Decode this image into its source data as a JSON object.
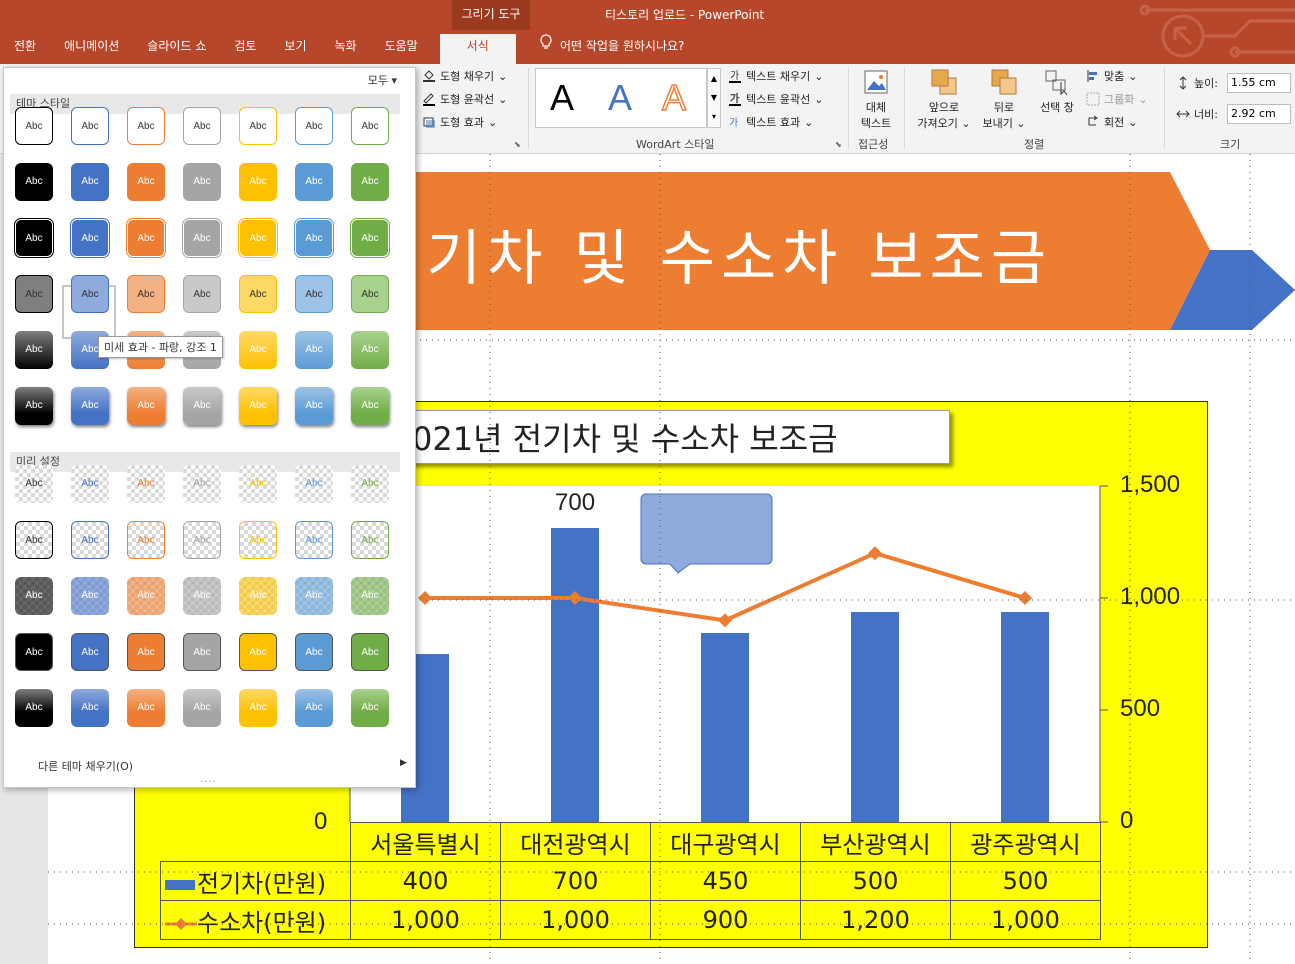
{
  "window": {
    "context_group": "그리기 도구",
    "doc_title": "티스토리 업로드  -  PowerPoint"
  },
  "tabs": [
    "전환",
    "애니메이션",
    "슬라이드 쇼",
    "검토",
    "보기",
    "녹화",
    "도움말",
    "서식"
  ],
  "active_tab": "서식",
  "tell_me": "어떤 작업을 원하시나요?",
  "ribbon": {
    "shape_fill": "도형 채우기",
    "shape_outline": "도형 윤곽선",
    "shape_effects": "도형 효과",
    "wordart_sample": "A",
    "text_fill": "텍스트 채우기",
    "text_outline": "텍스트 윤곽선",
    "text_effects": "텍스트 효과",
    "wordart_group": "WordArt 스타일",
    "alt_text_line1": "대체",
    "alt_text_line2": "텍스트",
    "accessibility_group": "접근성",
    "bring_forward_line1": "앞으로",
    "bring_forward_line2": "가져오기",
    "send_backward_line1": "뒤로",
    "send_backward_line2": "보내기",
    "selection_pane": "선택 창",
    "align": "맞춤",
    "group": "그룹화",
    "rotate": "회전",
    "arrange_group": "정렬",
    "height_label": "높이:",
    "height_value": "1.55 cm",
    "width_label": "너비:",
    "width_value": "2.92 cm",
    "size_group": "크기"
  },
  "gallery": {
    "filter": "모두",
    "section_theme": "테마 스타일",
    "section_presets": "미리 설정",
    "swatch_label": "Abc",
    "tooltip": "미세 효과 - 파랑, 강조 1",
    "more_fills": "다른 테마 채우기(O)",
    "grip": "....",
    "colors": [
      "#000000",
      "#4472c4",
      "#ed7d31",
      "#a5a5a5",
      "#ffc000",
      "#5b9bd5",
      "#70ad47"
    ],
    "light_colors": [
      "#7f7f7f",
      "#8faadc",
      "#f4b183",
      "#c9c9c9",
      "#ffd966",
      "#9dc3e6",
      "#a9d18e"
    ]
  },
  "slide": {
    "banner_text": "기차 및 수소차 보조금",
    "banner_color": "#ed7d31",
    "chart_bg": "#ffff00"
  },
  "chart_data": {
    "type": "bar",
    "title": "021년 전기차 및 수소차 보조금",
    "categories": [
      "서울특별시",
      "대전광역시",
      "대구광역시",
      "부산광역시",
      "광주광역시"
    ],
    "series": [
      {
        "name": "전기차(만원)",
        "type": "bar",
        "color": "#4472c4",
        "values": [
          400,
          700,
          450,
          500,
          500
        ]
      },
      {
        "name": "수소차(만원)",
        "type": "line",
        "color": "#ed7d31",
        "values": [
          1000,
          1000,
          900,
          1200,
          1000
        ]
      }
    ],
    "secondary_axis": {
      "ticks": [
        "1,500",
        "1,000",
        "500",
        "0"
      ],
      "ylim": [
        0,
        1500
      ]
    },
    "primary_axis": {
      "visible_ticks": [
        "0"
      ],
      "ylim": [
        0,
        800
      ]
    },
    "data_labels": {
      "bar_700": "700"
    },
    "data_table_rows": [
      [
        "400",
        "700",
        "450",
        "500",
        "500"
      ],
      [
        "1,000",
        "1,000",
        "900",
        "1,200",
        "1,000"
      ]
    ]
  }
}
